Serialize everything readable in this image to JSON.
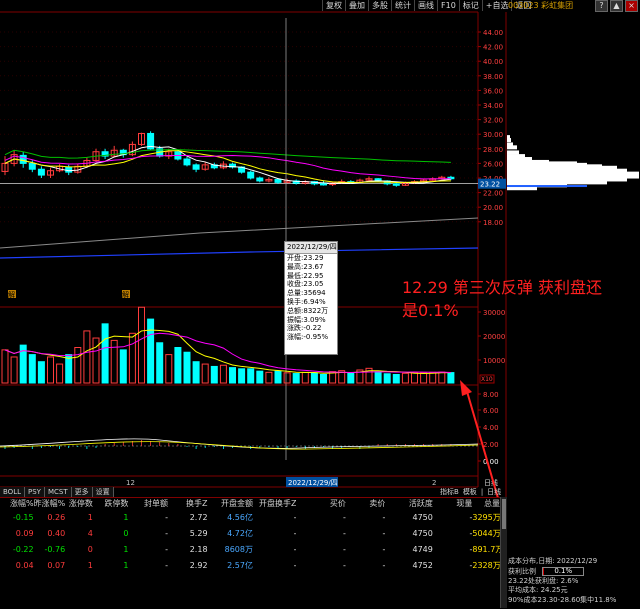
{
  "toolbar": [
    "复权",
    "叠加",
    "多股",
    "统计",
    "画线",
    "F10",
    "标记",
    "+自选",
    "返回"
  ],
  "stock_name": "003023 彩虹集团",
  "win_buttons": [
    "?",
    "▲",
    "×"
  ],
  "price_axis": {
    "ticks": [
      "44.00",
      "42.00",
      "40.00",
      "38.00",
      "36.00",
      "34.00",
      "32.00",
      "30.00",
      "28.00",
      "26.00",
      "24.00",
      "22.00",
      "20.00",
      "18.00"
    ],
    "current": "23.22"
  },
  "volume_axis": {
    "ticks": [
      "30000",
      "20000",
      "10000"
    ],
    "unit": "X10"
  },
  "macd_axis": {
    "ticks": [
      "8.00",
      "6.00",
      "4.00",
      "2.00",
      "0.00"
    ]
  },
  "month_labels": {
    "left": "12",
    "mid": "2022/12/29/四",
    "right": "2"
  },
  "markers": [
    "解",
    "解"
  ],
  "tooltip": {
    "date": "2022/12/29/四",
    "rows": [
      {
        "label": "开盘",
        "value": "23.29"
      },
      {
        "label": "最高",
        "value": "23.67"
      },
      {
        "label": "最低",
        "value": "22.95"
      },
      {
        "label": "收盘",
        "value": "23.05"
      },
      {
        "label": "总量",
        "value": "35694"
      },
      {
        "label": "换手",
        "value": "6.94%"
      },
      {
        "label": "总额",
        "value": "8322万"
      },
      {
        "label": "振幅",
        "value": "3.09%"
      },
      {
        "label": "涨跌",
        "value": "-0.22"
      },
      {
        "label": "涨幅",
        "value": "-0.95%"
      }
    ]
  },
  "annotation": [
    "12.29 第三次反弹 获利盘还",
    "是0.1%"
  ],
  "bottom_tabs": [
    "BOLL",
    "PSY",
    "MCST",
    "更多",
    "设置"
  ],
  "index_tabs": [
    "指标B",
    "模板",
    "|",
    "日线"
  ],
  "side_tab": "日线",
  "table": {
    "headers": [
      "涨幅%",
      "昨涨幅%",
      "涨停数",
      "跌停数",
      "封单额",
      "换手Z",
      "开盘金额",
      "开盘换手Z",
      "买价",
      "卖价",
      "活跃度",
      "现量",
      "总量"
    ],
    "rows": [
      [
        "-0.15",
        "0.26",
        "1",
        "1",
        "-",
        "2.72",
        "4.56亿",
        "-",
        "-",
        "-",
        "4750",
        "-",
        "3295万"
      ],
      [
        "0.09",
        "0.40",
        "4",
        "0",
        "-",
        "5.29",
        "4.72亿",
        "-",
        "-",
        "-",
        "4750",
        "-",
        "5044万"
      ],
      [
        "-0.22",
        "-0.76",
        "0",
        "1",
        "-",
        "2.18",
        "8608万",
        "-",
        "-",
        "-",
        "4749",
        "-",
        "891.7万"
      ],
      [
        "0.04",
        "0.07",
        "1",
        "1",
        "-",
        "2.92",
        "2.57亿",
        "-",
        "-",
        "-",
        "4752",
        "-",
        "2328万"
      ]
    ]
  },
  "cost_panel": {
    "line1": "成本分布,日期: 2022/12/29",
    "profit_label": "获利比例",
    "profit_value": "0.1%",
    "profit_ratio": 0.001,
    "line3": "23.22处获利盘: 2.6%",
    "line4": "平均成本: 24.25元",
    "line5": "90%成本23.30-28.60集中11.8%"
  },
  "colors": {
    "up": "#ff3c3c",
    "down": "#00ffff",
    "ma5": "#ffffff",
    "ma10": "#ffff00",
    "ma20": "#ff00ff",
    "ma60": "#00c000",
    "accent": "#ff2020"
  }
}
